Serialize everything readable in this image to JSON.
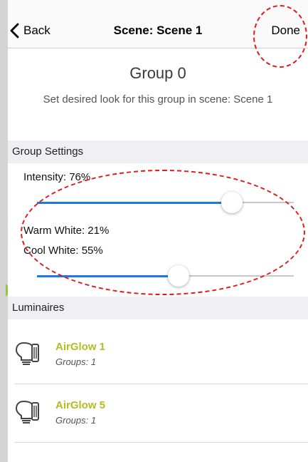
{
  "nav": {
    "back_label": "Back",
    "title": "Scene: Scene 1",
    "done_label": "Done"
  },
  "group": {
    "title": "Group 0",
    "description": "Set desired look for this group in scene: Scene 1"
  },
  "group_settings": {
    "header": "Group Settings",
    "intensity": {
      "label": "Intensity: 76%",
      "value": 0.76
    },
    "warm_white": {
      "label": "Warm White: 21%",
      "value": 0.21
    },
    "cool_white": {
      "label": "Cool White: 55%",
      "value": 0.55
    }
  },
  "luminaires": {
    "header": "Luminaires",
    "items": [
      {
        "name": "AirGlow 1",
        "groups": "Groups: 1"
      },
      {
        "name": "AirGlow 5",
        "groups": "Groups: 1"
      }
    ]
  },
  "colors": {
    "accent": "#1e7ae0",
    "luminaire_name": "#b5bd1e",
    "annotation": "#e11a1a",
    "arrow": "#8dc63f"
  }
}
